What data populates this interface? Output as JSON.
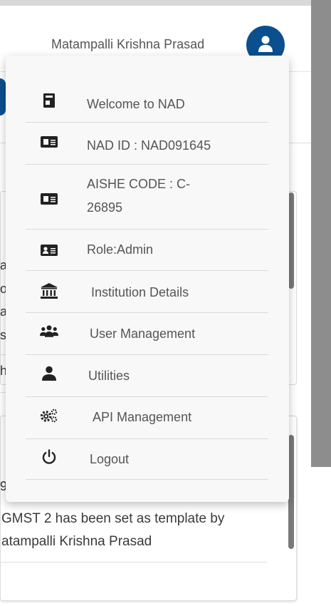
{
  "header": {
    "user_name": "Matampalli Krishna Prasad",
    "avatar_icon": "user-icon",
    "accent": "#0b4f8f"
  },
  "menu": {
    "items": [
      {
        "label": "Welcome to NAD",
        "icon": "document-icon"
      },
      {
        "label": "NAD ID : NAD091645",
        "icon": "id-card-icon"
      },
      {
        "label_line1": "AISHE CODE : C-",
        "label_line2": "26895",
        "icon": "id-card-icon"
      },
      {
        "label": "Role:Admin",
        "icon": "contact-card-icon"
      },
      {
        "label": "Institution Details",
        "icon": "institution-icon"
      },
      {
        "label": "User Management",
        "icon": "users-icon"
      },
      {
        "label": "Utilities",
        "icon": "user-icon"
      },
      {
        "label": "API Management",
        "icon": "cogs-icon"
      },
      {
        "label": "Logout",
        "icon": "power-icon"
      }
    ]
  },
  "background": {
    "letters": [
      "a",
      "o",
      "a",
      "s",
      "h",
      "9"
    ],
    "activity_line1": "GMST 2 has been set as template by",
    "activity_line2": "atampalli Krishna Prasad"
  }
}
